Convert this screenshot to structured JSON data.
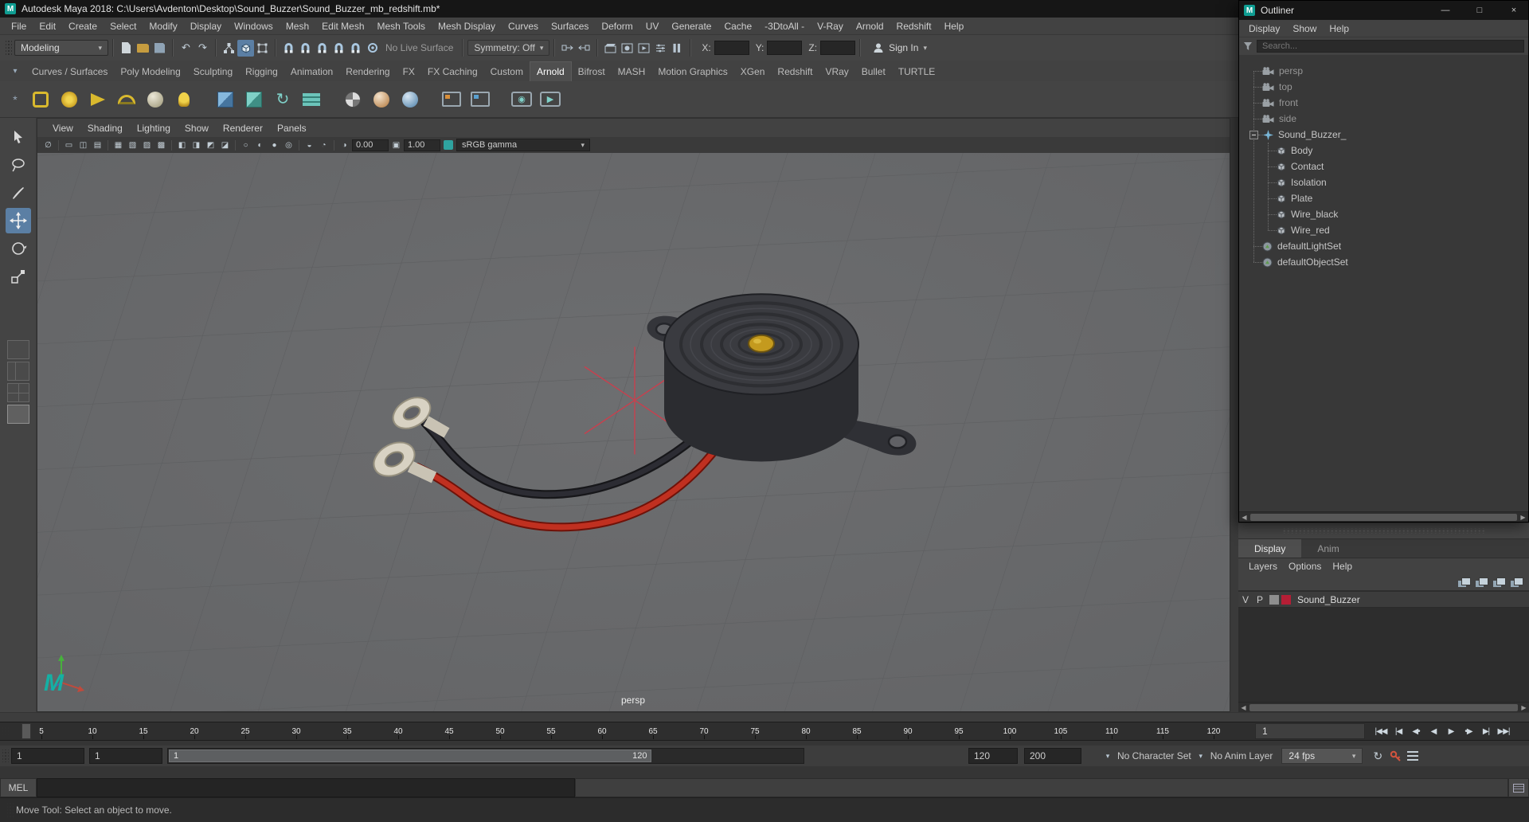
{
  "window": {
    "title": "Autodesk Maya 2018: C:\\Users\\Avdenton\\Desktop\\Sound_Buzzer\\Sound_Buzzer_mb_redshift.mb*"
  },
  "menus": [
    "File",
    "Edit",
    "Create",
    "Select",
    "Modify",
    "Display",
    "Windows",
    "Mesh",
    "Edit Mesh",
    "Mesh Tools",
    "Mesh Display",
    "Curves",
    "Surfaces",
    "Deform",
    "UV",
    "Generate",
    "Cache",
    "-3DtoAll -",
    "V-Ray",
    "Arnold",
    "Redshift",
    "Help"
  ],
  "status": {
    "mode": "Modeling",
    "live_surface": "No Live Surface",
    "symmetry": "Symmetry: Off",
    "x": "X:",
    "y": "Y:",
    "z": "Z:",
    "sign_in": "Sign In"
  },
  "shelf": {
    "tabs": [
      "Curves / Surfaces",
      "Poly Modeling",
      "Sculpting",
      "Rigging",
      "Animation",
      "Rendering",
      "FX",
      "FX Caching",
      "Custom",
      "Arnold",
      "Bifrost",
      "MASH",
      "Motion Graphics",
      "XGen",
      "Redshift",
      "VRay",
      "Bullet",
      "TURTLE"
    ],
    "active_tab": "Arnold"
  },
  "panel": {
    "menus": [
      "View",
      "Shading",
      "Lighting",
      "Show",
      "Renderer",
      "Panels"
    ],
    "exposure": "0.00",
    "gamma": "1.00",
    "view_transform": "sRGB gamma",
    "camera": "persp"
  },
  "outliner": {
    "title": "Outliner",
    "menus": [
      "Display",
      "Show",
      "Help"
    ],
    "search": "Search...",
    "items": [
      "persp",
      "top",
      "front",
      "side",
      "Sound_Buzzer_",
      "Body",
      "Contact",
      "Isolation",
      "Plate",
      "Wire_black",
      "Wire_red",
      "defaultLightSet",
      "defaultObjectSet"
    ]
  },
  "layers": {
    "tabs": [
      "Display",
      "Anim"
    ],
    "menus": [
      "Layers",
      "Options",
      "Help"
    ],
    "row": {
      "v": "V",
      "p": "P",
      "name": "Sound_Buzzer",
      "color": "#b51e35"
    }
  },
  "timeline": {
    "ticks": [
      "5",
      "10",
      "15",
      "20",
      "25",
      "30",
      "35",
      "40",
      "45",
      "50",
      "55",
      "60",
      "65",
      "70",
      "75",
      "80",
      "85",
      "90",
      "95",
      "100",
      "105",
      "110",
      "115",
      "120"
    ],
    "current": "1"
  },
  "playback": [
    "|◀◀",
    "|◀",
    "◀•",
    "◀",
    "▶",
    "•▶",
    "▶|",
    "▶▶|"
  ],
  "range": {
    "anim_start": "1",
    "play_start": "1",
    "handle_start": "1",
    "handle_end": "120",
    "play_end": "120",
    "anim_end": "200",
    "charset": "No Character Set",
    "animlayer": "No Anim Layer",
    "fps": "24 fps"
  },
  "cmd": {
    "label": "MEL"
  },
  "help": {
    "message": "Move Tool: Select an object to move."
  },
  "icons": {
    "dropdown": "▾",
    "undo": "↶",
    "redo": "↷",
    "pause": "▌▌",
    "swirl": "↻",
    "eye": "◉",
    "play": "▶",
    "loop": "↻",
    "min": "—",
    "max": "□",
    "close": "×",
    "left": "◀",
    "right": "▶",
    "m_logo": "M",
    "vp": [
      "∅",
      "▭",
      "◫",
      "▤",
      "▦",
      "▧",
      "▨",
      "▩",
      "◧",
      "◨",
      "◩",
      "◪",
      "○",
      "◐",
      "●",
      "◎",
      "◒",
      "◔",
      "◑",
      "▣"
    ]
  }
}
